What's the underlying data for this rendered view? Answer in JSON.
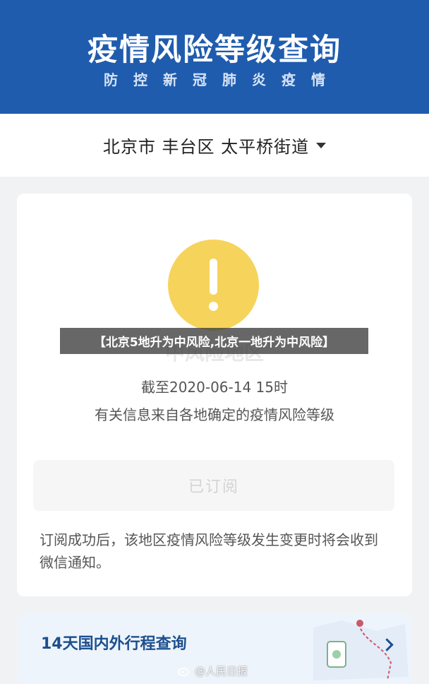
{
  "header": {
    "title": "疫情风险等级查询",
    "subtitle": "防控新冠肺炎疫情"
  },
  "location": {
    "text": "北京市 丰台区 太平桥街道"
  },
  "risk": {
    "level_text": "中风险地区",
    "deadline": "截至2020-06-14 15时",
    "basis": "有关信息来自各地确定的疫情风险等级",
    "color": "#f6d35b"
  },
  "subscribe": {
    "label": "已订阅",
    "note": "订阅成功后，该地区疫情风险等级发生变更时将会收到微信通知。"
  },
  "itinerary": {
    "label": "14天国内外行程查询"
  },
  "overlay": {
    "text": "【北京5地升为中风险,北京一地升为中风险】"
  },
  "watermark": {
    "text": "@人民日报"
  },
  "icons": [
    "warning-icon",
    "caret-down-icon",
    "chevron-right-icon",
    "weibo-icon"
  ]
}
